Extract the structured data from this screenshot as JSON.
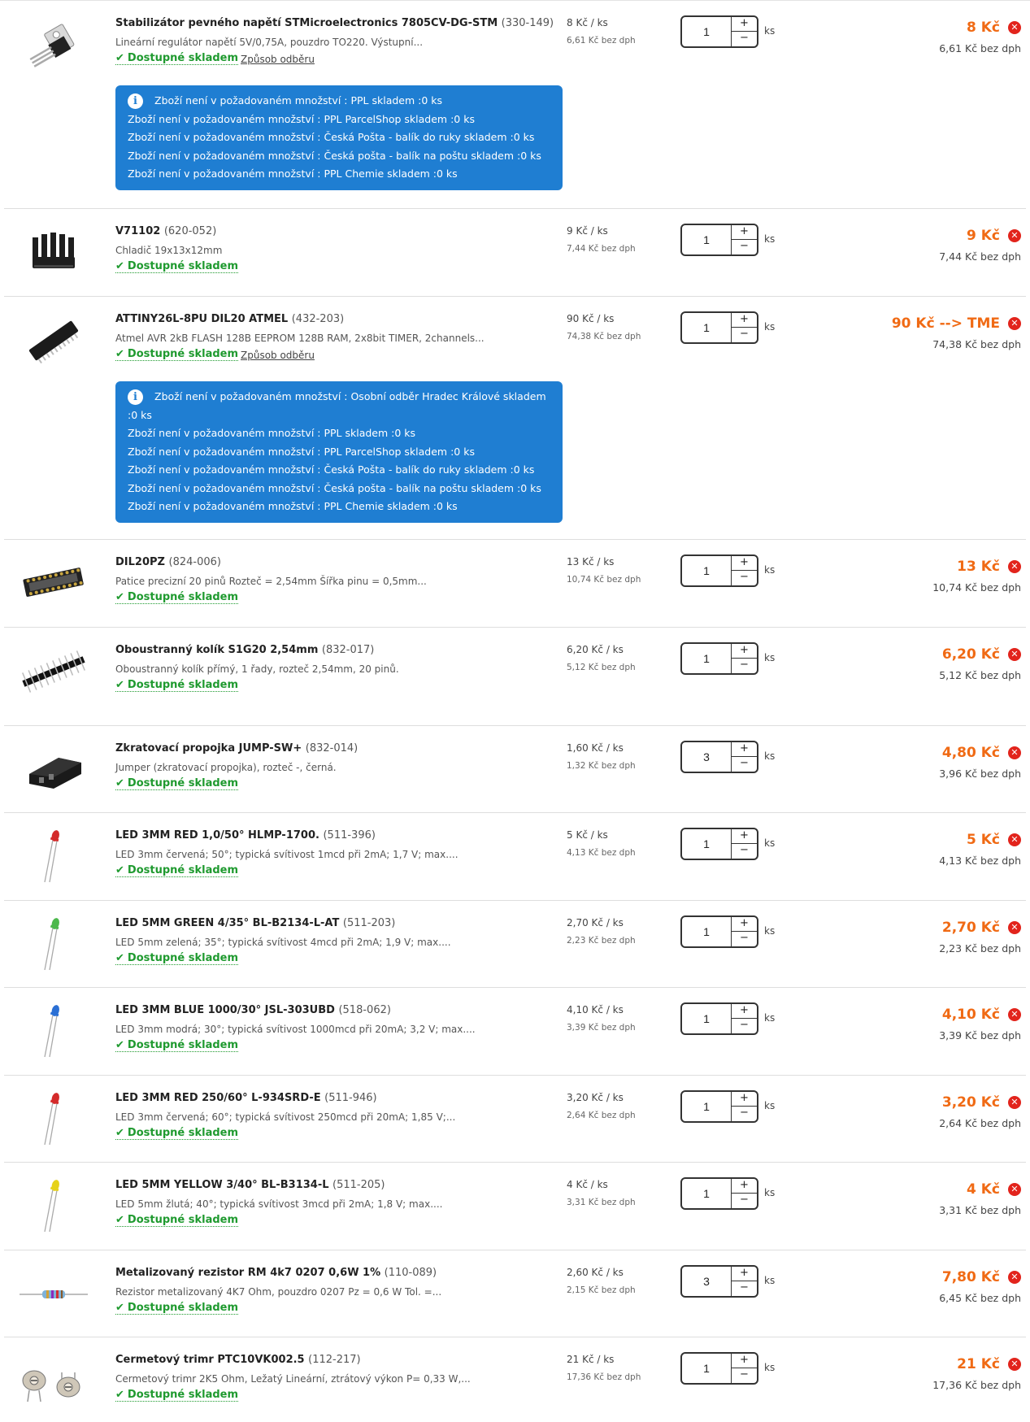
{
  "currency_note": "bez dph",
  "items": [
    {
      "title": "Stabilizátor pevného napětí STMicroelectronics 7805CV-DG-STM",
      "code": "(330-149)",
      "desc": "Lineární regulátor napětí 5V/0,75A, pouzdro TO220. Výstupní...",
      "stock": "Dostupné skladem",
      "pickup": "Způsob odběru",
      "unit_price": "8 Kč / ks",
      "unit_price_novat": "6,61 Kč bez dph",
      "qty": "1",
      "unit": "ks",
      "total": "8 Kč",
      "total_novat": "6,61 Kč bez dph",
      "icon": "voltage-regulator-icon",
      "notices": [
        "Zboží není v požadovaném množství : PPL skladem :0 ks",
        "Zboží není v požadovaném množství : PPL ParcelShop skladem :0 ks",
        "Zboží není v požadovaném množství : Česká Pošta - balík do ruky skladem :0 ks",
        "Zboží není v požadovaném množství : Česká pošta - balík na poštu skladem :0 ks",
        "Zboží není v požadovaném množství : PPL Chemie skladem :0 ks"
      ]
    },
    {
      "title": "V71102",
      "code": "(620-052)",
      "desc": "Chladič 19x13x12mm",
      "stock": "Dostupné skladem",
      "unit_price": "9 Kč / ks",
      "unit_price_novat": "7,44 Kč bez dph",
      "qty": "1",
      "unit": "ks",
      "total": "9 Kč",
      "total_novat": "7,44 Kč bez dph",
      "icon": "heatsink-icon"
    },
    {
      "title": "ATTINY26L-8PU DIL20 ATMEL",
      "code": "(432-203)",
      "desc": "Atmel AVR 2kB FLASH 128B EEPROM 128B RAM, 2x8bit TIMER, 2channels...",
      "stock": "Dostupné skladem",
      "pickup": "Způsob odběru",
      "unit_price": "90 Kč / ks",
      "unit_price_novat": "74,38 Kč bez dph",
      "qty": "1",
      "unit": "ks",
      "total": "90 Kč --> TME",
      "total_novat": "74,38 Kč bez dph",
      "icon": "ic-chip-icon",
      "notices": [
        "Zboží není v požadovaném množství : Osobní odběr Hradec Králové skladem :0 ks",
        "Zboží není v požadovaném množství : PPL skladem :0 ks",
        "Zboží není v požadovaném množství : PPL ParcelShop skladem :0 ks",
        "Zboží není v požadovaném množství : Česká Pošta - balík do ruky skladem :0 ks",
        "Zboží není v požadovaném množství : Česká pošta - balík na poštu skladem :0 ks",
        "Zboží není v požadovaném množství : PPL Chemie skladem :0 ks"
      ]
    },
    {
      "title": "DIL20PZ",
      "code": "(824-006)",
      "desc": "Patice precizní 20 pinů Rozteč = 2,54mm Šířka pinu = 0,5mm...",
      "stock": "Dostupné skladem",
      "unit_price": "13 Kč / ks",
      "unit_price_novat": "10,74 Kč bez dph",
      "qty": "1",
      "unit": "ks",
      "total": "13 Kč",
      "total_novat": "10,74 Kč bez dph",
      "icon": "ic-socket-icon"
    },
    {
      "title": "Oboustranný kolík S1G20 2,54mm",
      "code": "(832-017)",
      "desc": "Oboustranný kolík přímý, 1 řady, rozteč 2,54mm, 20 pinů.",
      "stock": "Dostupné skladem",
      "unit_price": "6,20 Kč / ks",
      "unit_price_novat": "5,12 Kč bez dph",
      "qty": "1",
      "unit": "ks",
      "total": "6,20 Kč",
      "total_novat": "5,12 Kč bez dph",
      "icon": "pin-header-icon"
    },
    {
      "title": "Zkratovací propojka JUMP-SW+",
      "code": "(832-014)",
      "desc": "Jumper (zkratovací propojka), rozteč -, černá.",
      "stock": "Dostupné skladem",
      "unit_price": "1,60 Kč / ks",
      "unit_price_novat": "1,32 Kč bez dph",
      "qty": "3",
      "unit": "ks",
      "total": "4,80 Kč",
      "total_novat": "3,96 Kč bez dph",
      "icon": "jumper-icon"
    },
    {
      "title": "LED 3MM RED 1,0/50° HLMP-1700.",
      "code": "(511-396)",
      "desc": "LED 3mm červená; 50°; typická svítivost 1mcd při 2mA; 1,7 V; max....",
      "stock": "Dostupné skladem",
      "unit_price": "5 Kč / ks",
      "unit_price_novat": "4,13 Kč bez dph",
      "qty": "1",
      "unit": "ks",
      "total": "5 Kč",
      "total_novat": "4,13 Kč bez dph",
      "icon": "led-red-icon",
      "led_color": "#d42a2a"
    },
    {
      "title": "LED 5MM GREEN 4/35° BL-B2134-L-AT",
      "code": "(511-203)",
      "desc": "LED 5mm zelená; 35°; typická svítivost 4mcd při 2mA; 1,9 V; max....",
      "stock": "Dostupné skladem",
      "unit_price": "2,70 Kč / ks",
      "unit_price_novat": "2,23 Kč bez dph",
      "qty": "1",
      "unit": "ks",
      "total": "2,70 Kč",
      "total_novat": "2,23 Kč bez dph",
      "icon": "led-green-icon",
      "led_color": "#4cb84c"
    },
    {
      "title": "LED 3MM BLUE 1000/30° JSL-303UBD",
      "code": "(518-062)",
      "desc": "LED 3mm modrá; 30°; typická svítivost 1000mcd při 20mA; 3,2 V; max....",
      "stock": "Dostupné skladem",
      "unit_price": "4,10 Kč / ks",
      "unit_price_novat": "3,39 Kč bez dph",
      "qty": "1",
      "unit": "ks",
      "total": "4,10 Kč",
      "total_novat": "3,39 Kč bez dph",
      "icon": "led-blue-icon",
      "led_color": "#2a6fd4"
    },
    {
      "title": "LED 3MM RED 250/60° L-934SRD-E",
      "code": "(511-946)",
      "desc": "LED 3mm červená; 60°; typická svítivost 250mcd při 20mA; 1,85 V;...",
      "stock": "Dostupné skladem",
      "unit_price": "3,20 Kč / ks",
      "unit_price_novat": "2,64 Kč bez dph",
      "qty": "1",
      "unit": "ks",
      "total": "3,20 Kč",
      "total_novat": "2,64 Kč bez dph",
      "icon": "led-red-icon",
      "led_color": "#d42a2a"
    },
    {
      "title": "LED 5MM YELLOW 3/40° BL-B3134-L",
      "code": "(511-205)",
      "desc": "LED 5mm žlutá; 40°; typická svítivost 3mcd při 2mA; 1,8 V; max....",
      "stock": "Dostupné skladem",
      "unit_price": "4 Kč / ks",
      "unit_price_novat": "3,31 Kč bez dph",
      "qty": "1",
      "unit": "ks",
      "total": "4 Kč",
      "total_novat": "3,31 Kč bez dph",
      "icon": "led-yellow-icon",
      "led_color": "#e6d21a"
    },
    {
      "title": "Metalizovaný rezistor RM 4k7 0207 0,6W 1%",
      "code": "(110-089)",
      "desc": "Rezistor metalizovaný 4K7 Ohm, pouzdro 0207 Pz = 0,6 W Tol. =...",
      "stock": "Dostupné skladem",
      "unit_price": "2,60 Kč / ks",
      "unit_price_novat": "2,15 Kč bez dph",
      "qty": "3",
      "unit": "ks",
      "total": "7,80 Kč",
      "total_novat": "6,45 Kč bez dph",
      "icon": "resistor-icon"
    },
    {
      "title": "Cermetový trimr PTC10VK002.5",
      "code": "(112-217)",
      "desc": "Cermetový trimr 2K5 Ohm, Ležatý Lineární, ztrátový výkon P= 0,33 W,...",
      "stock": "Dostupné skladem",
      "unit_price": "21 Kč / ks",
      "unit_price_novat": "17,36 Kč bez dph",
      "qty": "1",
      "unit": "ks",
      "total": "21 Kč",
      "total_novat": "17,36 Kč bez dph",
      "icon": "trimmer-icon"
    }
  ],
  "colors": {
    "stock_green": "#1f9a2f",
    "price_orange": "#f06a14",
    "notice_blue": "#1f7ed2",
    "remove_red": "#e2241c"
  }
}
